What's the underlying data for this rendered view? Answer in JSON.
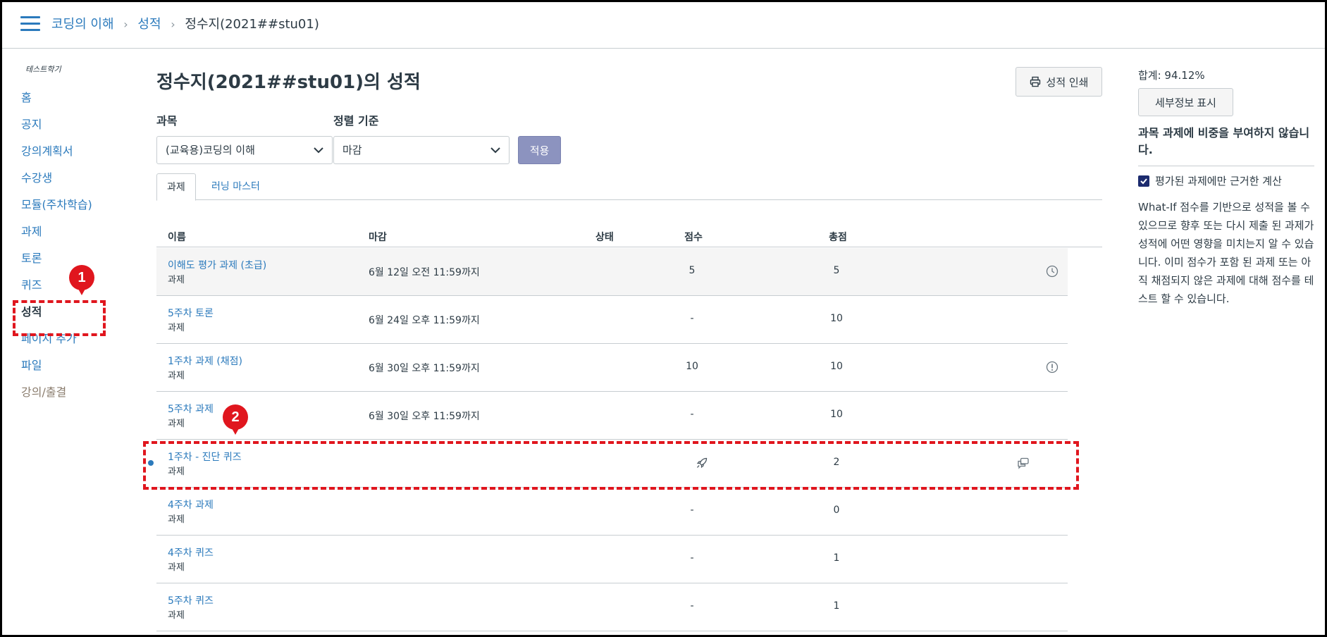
{
  "breadcrumb": {
    "course": "코딩의 이해",
    "section": "성적",
    "current": "정수지(2021##stu01)",
    "separator": "›"
  },
  "nav": {
    "term": "테스트학기",
    "items": [
      {
        "label": "홈"
      },
      {
        "label": "공지"
      },
      {
        "label": "강의계획서"
      },
      {
        "label": "수강생"
      },
      {
        "label": "모듈(주차학습)"
      },
      {
        "label": "과제"
      },
      {
        "label": "토론"
      },
      {
        "label": "퀴즈"
      },
      {
        "label": "성적"
      },
      {
        "label": "페이지 추가"
      },
      {
        "label": "파일"
      },
      {
        "label": "강의/출결"
      }
    ]
  },
  "main": {
    "title": "정수지(2021##stu01)의 성적",
    "print_label": "성적 인쇄",
    "course_label": "과목",
    "course_value": "(교육용)코딩의 이해",
    "sort_label": "정렬 기준",
    "sort_value": "마감",
    "apply_label": "적용",
    "tabs": [
      {
        "label": "과제"
      },
      {
        "label": "러닝 마스터"
      }
    ]
  },
  "table": {
    "headers": {
      "name": "이름",
      "due": "마감",
      "status": "상태",
      "score": "점수",
      "total": "총점"
    },
    "rows": [
      {
        "name": "이해도 평가 과제 (초급)",
        "type": "과제",
        "due": "6월 12일 오전 11:59까지",
        "score": "5",
        "total": "5",
        "icon": "clock-icon"
      },
      {
        "name": "5주차 토론",
        "type": "과제",
        "due": "6월 24일 오후 11:59까지",
        "score": "-",
        "total": "10",
        "icon": ""
      },
      {
        "name": "1주차 과제 (채점)",
        "type": "과제",
        "due": "6월 30일 오후 11:59까지",
        "score": "10",
        "total": "10",
        "icon": "alert-circle-icon"
      },
      {
        "name": "5주차 과제",
        "type": "과제",
        "due": "6월 30일 오후 11:59까지",
        "score": "-",
        "total": "10",
        "icon": ""
      },
      {
        "name": "1주차 - 진단 퀴즈",
        "type": "과제",
        "due": "",
        "score": "",
        "total": "2",
        "icon": "comments-icon",
        "score_icon": "rocket-icon"
      },
      {
        "name": "4주차 과제",
        "type": "과제",
        "due": "",
        "score": "-",
        "total": "0",
        "icon": ""
      },
      {
        "name": "4주차 퀴즈",
        "type": "과제",
        "due": "",
        "score": "-",
        "total": "1",
        "icon": ""
      },
      {
        "name": "5주차 퀴즈",
        "type": "과제",
        "due": "",
        "score": "-",
        "total": "1",
        "icon": ""
      }
    ]
  },
  "right_panel": {
    "total": "합계: 94.12%",
    "details_label": "세부정보 표시",
    "note": "과목 과제에 비중을 부여하지 않습니다.",
    "checkbox_label": "평가된 과제에만 근거한 계산",
    "description": "What-If 점수를 기반으로 성적을 볼 수 있으므로 향후 또는 다시 제출 된 과제가 성적에 어떤 영향을 미치는지 알 수 있습니다. 이미 점수가 포함 된 과제 또는 아직 채점되지 않은 과제에 대해 점수를 테스트 할 수 있습니다."
  },
  "annotations": {
    "badge1": "1",
    "badge2": "2",
    "color": "#e0161e"
  },
  "colors": {
    "link": "#2b7abc",
    "text": "#2d3b45",
    "apply_button": "#8c93bf"
  }
}
